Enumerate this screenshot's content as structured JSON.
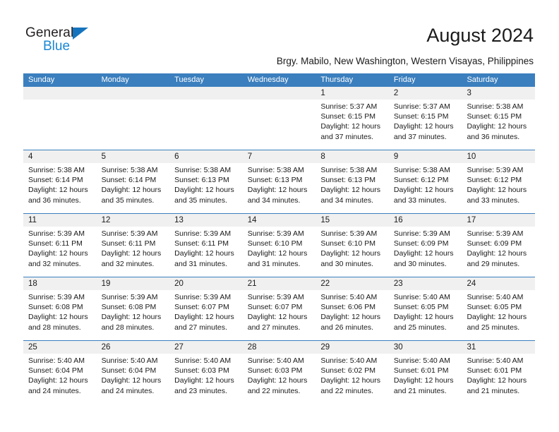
{
  "brand": {
    "name_part1": "General",
    "name_part2": "Blue",
    "triangle_color": "#1574bd",
    "blue_color": "#1b87d4"
  },
  "header": {
    "title": "August 2024",
    "subtitle": "Brgy. Mabilo, New Washington, Western Visayas, Philippines"
  },
  "theme": {
    "header_blue": "#3b7fbe",
    "day_band_gray": "#f0f0f0",
    "text_color": "#1a1a1a"
  },
  "calendar": {
    "weekdays": [
      "Sunday",
      "Monday",
      "Tuesday",
      "Wednesday",
      "Thursday",
      "Friday",
      "Saturday"
    ],
    "weeks": [
      [
        {
          "day": "",
          "sunrise": "",
          "sunset": "",
          "daylight_line1": "",
          "daylight_line2": ""
        },
        {
          "day": "",
          "sunrise": "",
          "sunset": "",
          "daylight_line1": "",
          "daylight_line2": ""
        },
        {
          "day": "",
          "sunrise": "",
          "sunset": "",
          "daylight_line1": "",
          "daylight_line2": ""
        },
        {
          "day": "",
          "sunrise": "",
          "sunset": "",
          "daylight_line1": "",
          "daylight_line2": ""
        },
        {
          "day": "1",
          "sunrise": "Sunrise: 5:37 AM",
          "sunset": "Sunset: 6:15 PM",
          "daylight_line1": "Daylight: 12 hours",
          "daylight_line2": "and 37 minutes."
        },
        {
          "day": "2",
          "sunrise": "Sunrise: 5:37 AM",
          "sunset": "Sunset: 6:15 PM",
          "daylight_line1": "Daylight: 12 hours",
          "daylight_line2": "and 37 minutes."
        },
        {
          "day": "3",
          "sunrise": "Sunrise: 5:38 AM",
          "sunset": "Sunset: 6:15 PM",
          "daylight_line1": "Daylight: 12 hours",
          "daylight_line2": "and 36 minutes."
        }
      ],
      [
        {
          "day": "4",
          "sunrise": "Sunrise: 5:38 AM",
          "sunset": "Sunset: 6:14 PM",
          "daylight_line1": "Daylight: 12 hours",
          "daylight_line2": "and 36 minutes."
        },
        {
          "day": "5",
          "sunrise": "Sunrise: 5:38 AM",
          "sunset": "Sunset: 6:14 PM",
          "daylight_line1": "Daylight: 12 hours",
          "daylight_line2": "and 35 minutes."
        },
        {
          "day": "6",
          "sunrise": "Sunrise: 5:38 AM",
          "sunset": "Sunset: 6:13 PM",
          "daylight_line1": "Daylight: 12 hours",
          "daylight_line2": "and 35 minutes."
        },
        {
          "day": "7",
          "sunrise": "Sunrise: 5:38 AM",
          "sunset": "Sunset: 6:13 PM",
          "daylight_line1": "Daylight: 12 hours",
          "daylight_line2": "and 34 minutes."
        },
        {
          "day": "8",
          "sunrise": "Sunrise: 5:38 AM",
          "sunset": "Sunset: 6:13 PM",
          "daylight_line1": "Daylight: 12 hours",
          "daylight_line2": "and 34 minutes."
        },
        {
          "day": "9",
          "sunrise": "Sunrise: 5:38 AM",
          "sunset": "Sunset: 6:12 PM",
          "daylight_line1": "Daylight: 12 hours",
          "daylight_line2": "and 33 minutes."
        },
        {
          "day": "10",
          "sunrise": "Sunrise: 5:39 AM",
          "sunset": "Sunset: 6:12 PM",
          "daylight_line1": "Daylight: 12 hours",
          "daylight_line2": "and 33 minutes."
        }
      ],
      [
        {
          "day": "11",
          "sunrise": "Sunrise: 5:39 AM",
          "sunset": "Sunset: 6:11 PM",
          "daylight_line1": "Daylight: 12 hours",
          "daylight_line2": "and 32 minutes."
        },
        {
          "day": "12",
          "sunrise": "Sunrise: 5:39 AM",
          "sunset": "Sunset: 6:11 PM",
          "daylight_line1": "Daylight: 12 hours",
          "daylight_line2": "and 32 minutes."
        },
        {
          "day": "13",
          "sunrise": "Sunrise: 5:39 AM",
          "sunset": "Sunset: 6:11 PM",
          "daylight_line1": "Daylight: 12 hours",
          "daylight_line2": "and 31 minutes."
        },
        {
          "day": "14",
          "sunrise": "Sunrise: 5:39 AM",
          "sunset": "Sunset: 6:10 PM",
          "daylight_line1": "Daylight: 12 hours",
          "daylight_line2": "and 31 minutes."
        },
        {
          "day": "15",
          "sunrise": "Sunrise: 5:39 AM",
          "sunset": "Sunset: 6:10 PM",
          "daylight_line1": "Daylight: 12 hours",
          "daylight_line2": "and 30 minutes."
        },
        {
          "day": "16",
          "sunrise": "Sunrise: 5:39 AM",
          "sunset": "Sunset: 6:09 PM",
          "daylight_line1": "Daylight: 12 hours",
          "daylight_line2": "and 30 minutes."
        },
        {
          "day": "17",
          "sunrise": "Sunrise: 5:39 AM",
          "sunset": "Sunset: 6:09 PM",
          "daylight_line1": "Daylight: 12 hours",
          "daylight_line2": "and 29 minutes."
        }
      ],
      [
        {
          "day": "18",
          "sunrise": "Sunrise: 5:39 AM",
          "sunset": "Sunset: 6:08 PM",
          "daylight_line1": "Daylight: 12 hours",
          "daylight_line2": "and 28 minutes."
        },
        {
          "day": "19",
          "sunrise": "Sunrise: 5:39 AM",
          "sunset": "Sunset: 6:08 PM",
          "daylight_line1": "Daylight: 12 hours",
          "daylight_line2": "and 28 minutes."
        },
        {
          "day": "20",
          "sunrise": "Sunrise: 5:39 AM",
          "sunset": "Sunset: 6:07 PM",
          "daylight_line1": "Daylight: 12 hours",
          "daylight_line2": "and 27 minutes."
        },
        {
          "day": "21",
          "sunrise": "Sunrise: 5:39 AM",
          "sunset": "Sunset: 6:07 PM",
          "daylight_line1": "Daylight: 12 hours",
          "daylight_line2": "and 27 minutes."
        },
        {
          "day": "22",
          "sunrise": "Sunrise: 5:40 AM",
          "sunset": "Sunset: 6:06 PM",
          "daylight_line1": "Daylight: 12 hours",
          "daylight_line2": "and 26 minutes."
        },
        {
          "day": "23",
          "sunrise": "Sunrise: 5:40 AM",
          "sunset": "Sunset: 6:05 PM",
          "daylight_line1": "Daylight: 12 hours",
          "daylight_line2": "and 25 minutes."
        },
        {
          "day": "24",
          "sunrise": "Sunrise: 5:40 AM",
          "sunset": "Sunset: 6:05 PM",
          "daylight_line1": "Daylight: 12 hours",
          "daylight_line2": "and 25 minutes."
        }
      ],
      [
        {
          "day": "25",
          "sunrise": "Sunrise: 5:40 AM",
          "sunset": "Sunset: 6:04 PM",
          "daylight_line1": "Daylight: 12 hours",
          "daylight_line2": "and 24 minutes."
        },
        {
          "day": "26",
          "sunrise": "Sunrise: 5:40 AM",
          "sunset": "Sunset: 6:04 PM",
          "daylight_line1": "Daylight: 12 hours",
          "daylight_line2": "and 24 minutes."
        },
        {
          "day": "27",
          "sunrise": "Sunrise: 5:40 AM",
          "sunset": "Sunset: 6:03 PM",
          "daylight_line1": "Daylight: 12 hours",
          "daylight_line2": "and 23 minutes."
        },
        {
          "day": "28",
          "sunrise": "Sunrise: 5:40 AM",
          "sunset": "Sunset: 6:03 PM",
          "daylight_line1": "Daylight: 12 hours",
          "daylight_line2": "and 22 minutes."
        },
        {
          "day": "29",
          "sunrise": "Sunrise: 5:40 AM",
          "sunset": "Sunset: 6:02 PM",
          "daylight_line1": "Daylight: 12 hours",
          "daylight_line2": "and 22 minutes."
        },
        {
          "day": "30",
          "sunrise": "Sunrise: 5:40 AM",
          "sunset": "Sunset: 6:01 PM",
          "daylight_line1": "Daylight: 12 hours",
          "daylight_line2": "and 21 minutes."
        },
        {
          "day": "31",
          "sunrise": "Sunrise: 5:40 AM",
          "sunset": "Sunset: 6:01 PM",
          "daylight_line1": "Daylight: 12 hours",
          "daylight_line2": "and 21 minutes."
        }
      ]
    ]
  }
}
